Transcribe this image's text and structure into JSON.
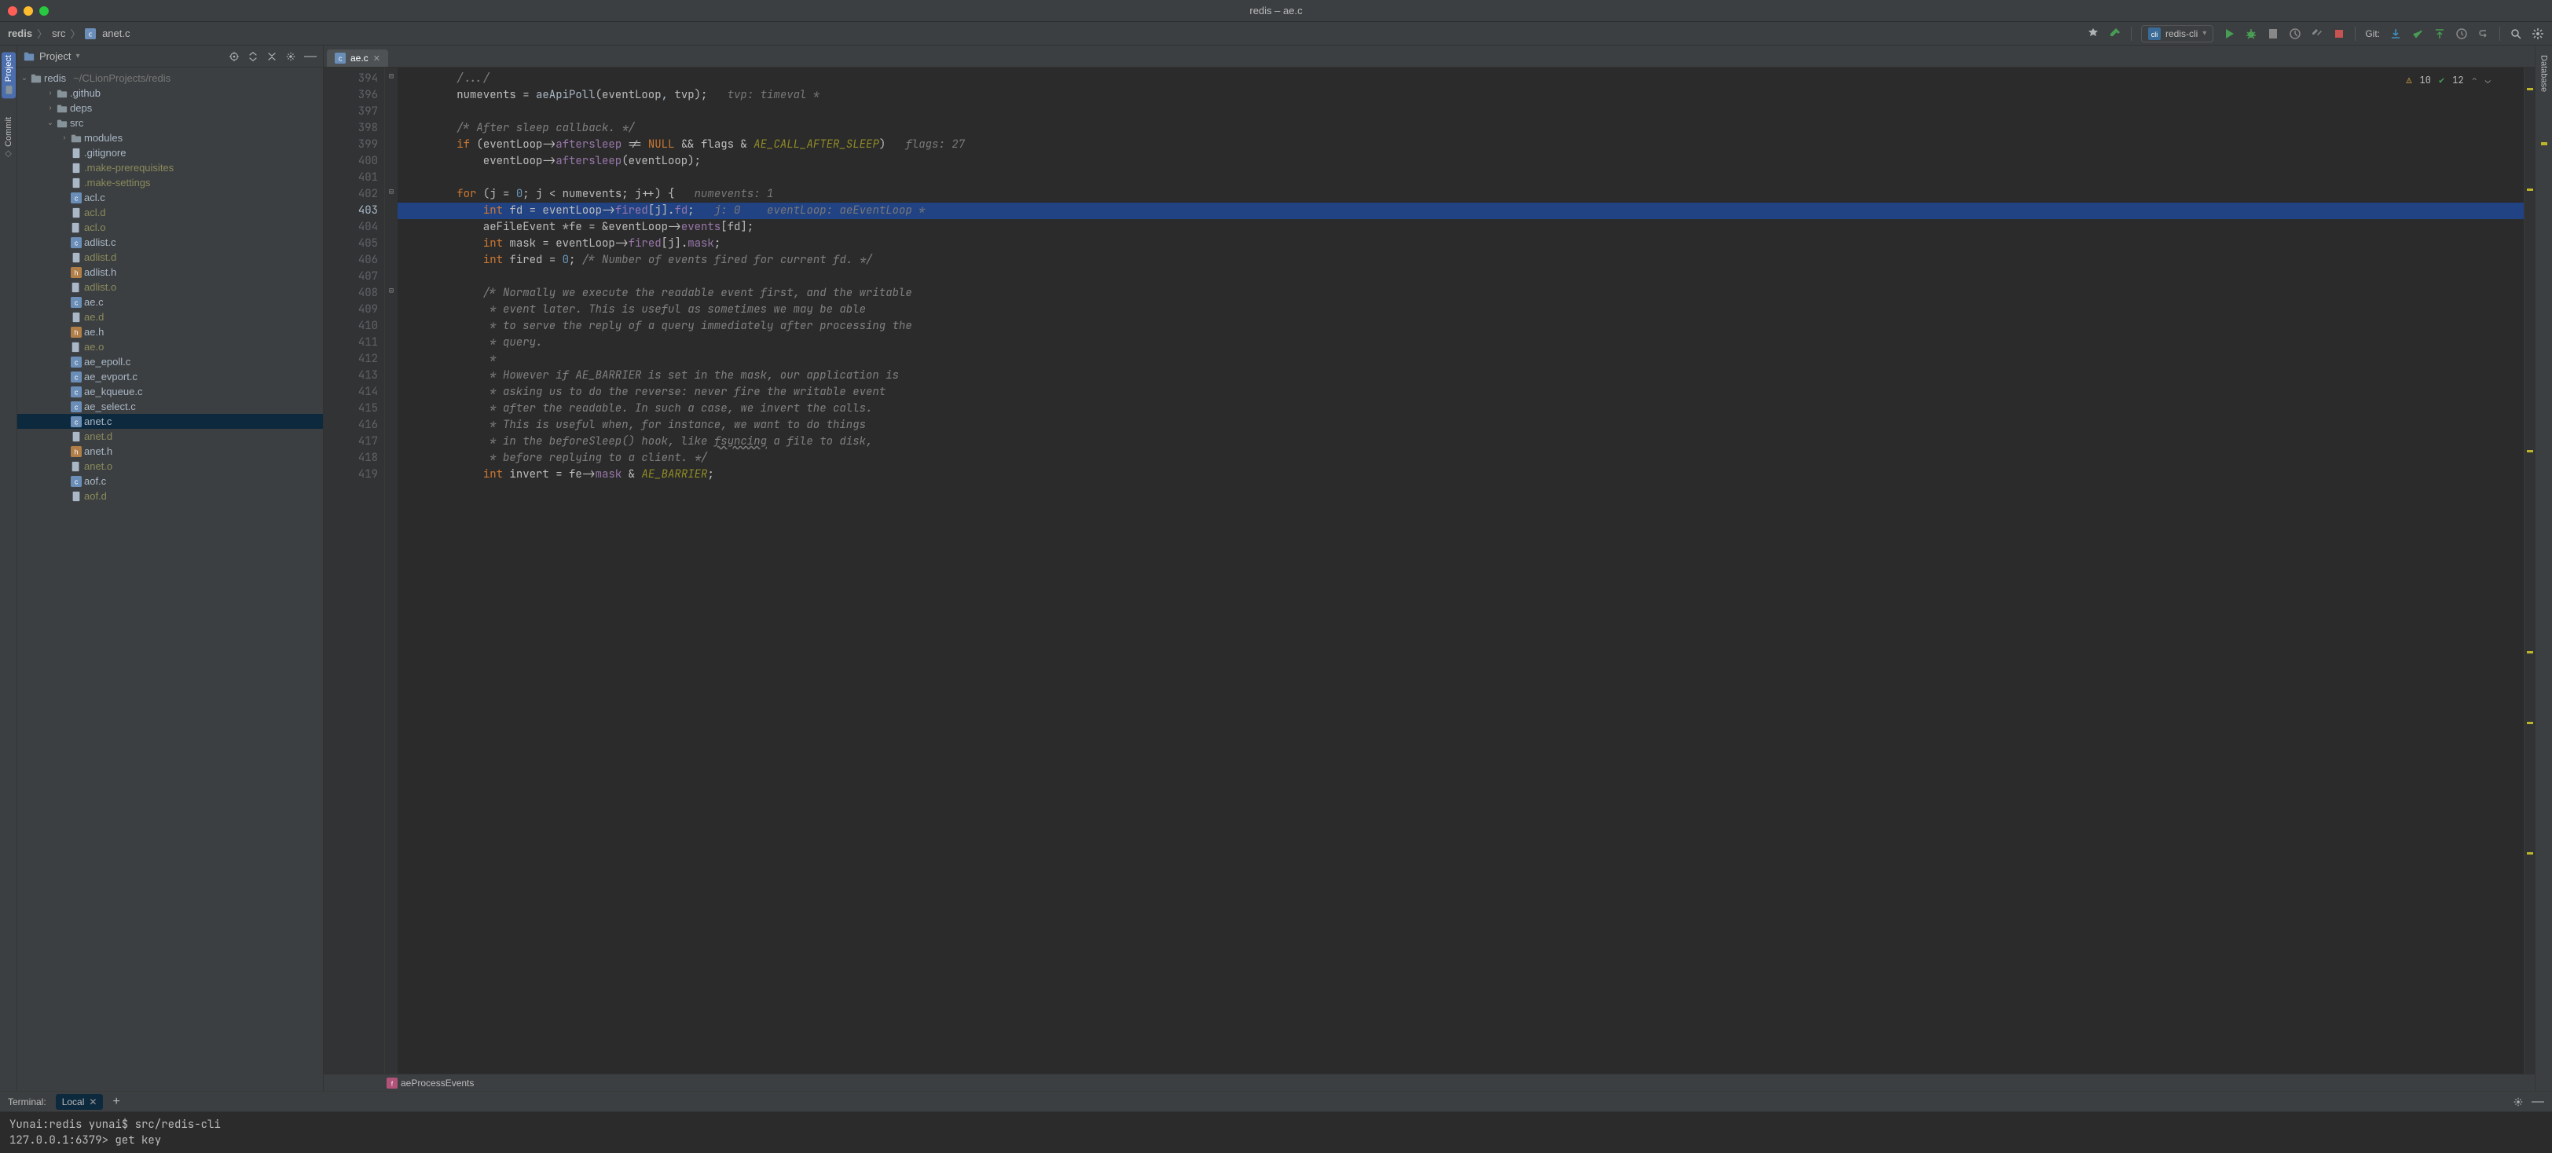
{
  "window": {
    "title": "redis – ae.c"
  },
  "breadcrumb": {
    "items": [
      "redis",
      "src",
      "anet.c"
    ]
  },
  "toolbar": {
    "run_config_label": "redis-cli",
    "git_label": "Git:"
  },
  "vtools_left": {
    "project": "Project",
    "commit": "Commit"
  },
  "vtools_right": {
    "database": "Database"
  },
  "project_panel": {
    "title": "Project",
    "root_name": "redis",
    "root_path": "~/CLionProjects/redis",
    "items": [
      {
        "name": ".github",
        "type": "folder",
        "indent": 1,
        "caret": ">"
      },
      {
        "name": "deps",
        "type": "folder",
        "indent": 1,
        "caret": ">"
      },
      {
        "name": "src",
        "type": "folder",
        "indent": 1,
        "caret": "v"
      },
      {
        "name": "modules",
        "type": "folder",
        "indent": 2,
        "caret": ">"
      },
      {
        "name": ".gitignore",
        "type": "text",
        "indent": 2
      },
      {
        "name": ".make-prerequisites",
        "type": "text",
        "indent": 2,
        "olive": true
      },
      {
        "name": ".make-settings",
        "type": "text",
        "indent": 2,
        "olive": true
      },
      {
        "name": "acl.c",
        "type": "c",
        "indent": 2
      },
      {
        "name": "acl.d",
        "type": "text",
        "indent": 2,
        "olive": true
      },
      {
        "name": "acl.o",
        "type": "o",
        "indent": 2,
        "olive": true
      },
      {
        "name": "adlist.c",
        "type": "c",
        "indent": 2
      },
      {
        "name": "adlist.d",
        "type": "text",
        "indent": 2,
        "olive": true
      },
      {
        "name": "adlist.h",
        "type": "h",
        "indent": 2
      },
      {
        "name": "adlist.o",
        "type": "o",
        "indent": 2,
        "olive": true
      },
      {
        "name": "ae.c",
        "type": "c",
        "indent": 2
      },
      {
        "name": "ae.d",
        "type": "text",
        "indent": 2,
        "olive": true
      },
      {
        "name": "ae.h",
        "type": "h",
        "indent": 2
      },
      {
        "name": "ae.o",
        "type": "o",
        "indent": 2,
        "olive": true
      },
      {
        "name": "ae_epoll.c",
        "type": "c",
        "indent": 2
      },
      {
        "name": "ae_evport.c",
        "type": "c",
        "indent": 2
      },
      {
        "name": "ae_kqueue.c",
        "type": "c",
        "indent": 2
      },
      {
        "name": "ae_select.c",
        "type": "c",
        "indent": 2
      },
      {
        "name": "anet.c",
        "type": "c",
        "indent": 2,
        "selected": true
      },
      {
        "name": "anet.d",
        "type": "text",
        "indent": 2,
        "olive": true
      },
      {
        "name": "anet.h",
        "type": "h",
        "indent": 2
      },
      {
        "name": "anet.o",
        "type": "o",
        "indent": 2,
        "olive": true
      },
      {
        "name": "aof.c",
        "type": "c",
        "indent": 2
      },
      {
        "name": "aof.d",
        "type": "text",
        "indent": 2,
        "olive": true
      }
    ]
  },
  "editor": {
    "tab_label": "ae.c",
    "warnings": "10",
    "checks": "12",
    "line_start": 394,
    "breakpoint_line": 403,
    "lines": [
      {
        "n": 394,
        "html": "        <span class='cmt'>/.../</span>"
      },
      {
        "n": 396,
        "html": "        numevents = <span class='fn'>aeApiPoll</span>(eventLoop<span class='op'>,</span> tvp);   <span class='hint'>tvp: timeval *</span>"
      },
      {
        "n": 397,
        "html": ""
      },
      {
        "n": 398,
        "html": "        <span class='cmt'>/* After sleep callback. */</span>"
      },
      {
        "n": 399,
        "html": "        <span class='kw'>if</span> (eventLoop-&gt;<span class='field'>aftersleep</span> != <span class='kw'>NULL</span> &amp;&amp; flags &amp; <span class='macro'>AE_CALL_AFTER_SLEEP</span>)   <span class='hint'>flags: 27</span>"
      },
      {
        "n": 400,
        "html": "            eventLoop-&gt;<span class='field'>aftersleep</span>(eventLoop);"
      },
      {
        "n": 401,
        "html": ""
      },
      {
        "n": 402,
        "html": "        <span class='kw'>for</span> (j = <span class='num'>0</span>; j &lt; numevents; j++) {   <span class='hint'>numevents: 1</span>"
      },
      {
        "n": 403,
        "html": "            <span class='kw'>int</span> fd = eventLoop-&gt;<span class='field'>fired</span>[j].<span class='field'>fd</span>;   <span class='hint'>j: 0    eventLoop: aeEventLoop *</span>",
        "hl": true
      },
      {
        "n": 404,
        "html": "            aeFileEvent *fe = &amp;eventLoop-&gt;<span class='field'>events</span>[fd];"
      },
      {
        "n": 405,
        "html": "            <span class='kw'>int</span> mask = eventLoop-&gt;<span class='field'>fired</span>[j].<span class='field'>mask</span>;"
      },
      {
        "n": 406,
        "html": "            <span class='kw'>int</span> fired = <span class='num'>0</span>; <span class='cmt'>/* Number of events fired for current fd. */</span>"
      },
      {
        "n": 407,
        "html": ""
      },
      {
        "n": 408,
        "html": "            <span class='cmt'>/* Normally we execute the readable event first, and the writable</span>"
      },
      {
        "n": 409,
        "html": "            <span class='cmt'> * event later. This is useful as sometimes we may be able</span>"
      },
      {
        "n": 410,
        "html": "            <span class='cmt'> * to serve the reply of a query immediately after processing the</span>"
      },
      {
        "n": 411,
        "html": "            <span class='cmt'> * query.</span>"
      },
      {
        "n": 412,
        "html": "            <span class='cmt'> *</span>"
      },
      {
        "n": 413,
        "html": "            <span class='cmt'> * However if AE_BARRIER is set in the mask, our application is</span>"
      },
      {
        "n": 414,
        "html": "            <span class='cmt'> * asking us to do the reverse: never fire the writable event</span>"
      },
      {
        "n": 415,
        "html": "            <span class='cmt'> * after the readable. In such a case, we invert the calls.</span>"
      },
      {
        "n": 416,
        "html": "            <span class='cmt'> * This is useful when, for instance, we want to do things</span>"
      },
      {
        "n": 417,
        "html": "            <span class='cmt'> * in the beforeSleep() hook, like <span class='underline'>fsyncing</span> a file to disk,</span>"
      },
      {
        "n": 418,
        "html": "            <span class='cmt'> * before replying to a client. */</span>"
      },
      {
        "n": 419,
        "html": "            <span class='kw'>int</span> invert = fe-&gt;<span class='field'>mask</span> &amp; <span class='macro'>AE_BARRIER</span>;"
      }
    ],
    "crumb_fn": "aeProcessEvents",
    "err_marks_pct": [
      2,
      12,
      38,
      58,
      65,
      78
    ]
  },
  "terminal": {
    "title": "Terminal:",
    "tab": "Local",
    "lines": [
      "Yunai:redis yunai$ src/redis-cli",
      "127.0.0.1:6379> get key"
    ]
  }
}
